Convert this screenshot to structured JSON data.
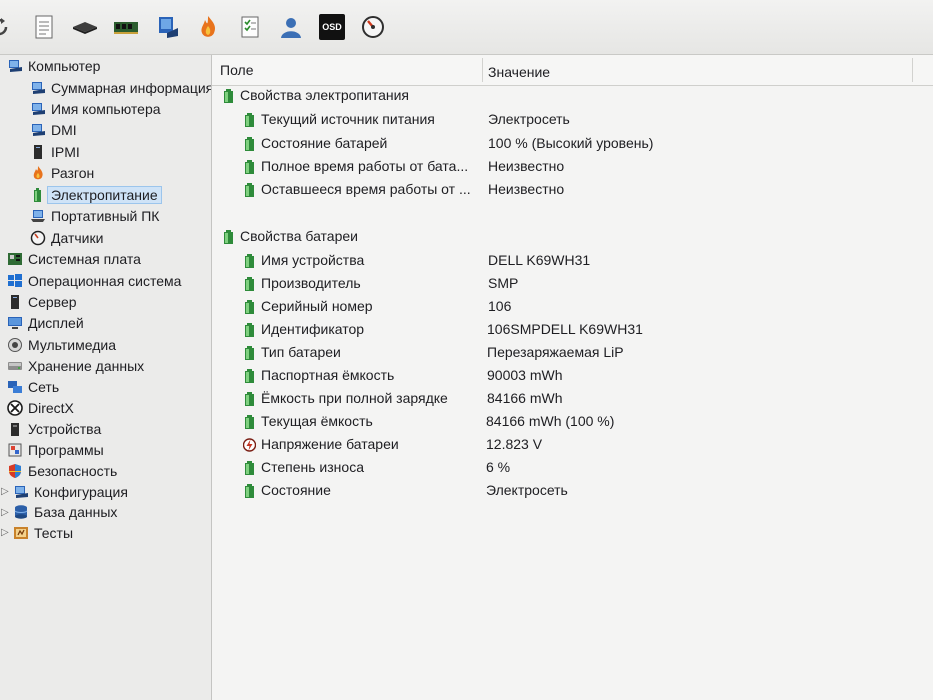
{
  "toolbar": {
    "icons": [
      "refresh-icon",
      "report-icon",
      "disk-icon",
      "memory-icon",
      "computer-icon",
      "flame-icon",
      "checklist-icon",
      "user-icon",
      "osd-icon",
      "gauge-icon"
    ],
    "osd_label": "OSD"
  },
  "tree": {
    "items": [
      {
        "label": "Компьютер",
        "icon": "computer-icon",
        "level": 0,
        "expanded": true
      },
      {
        "label": "Суммарная информация",
        "icon": "computer-icon",
        "level": 1
      },
      {
        "label": "Имя компьютера",
        "icon": "computer-icon",
        "level": 1
      },
      {
        "label": "DMI",
        "icon": "computer-icon",
        "level": 1
      },
      {
        "label": "IPMI",
        "icon": "server-icon",
        "level": 1
      },
      {
        "label": "Разгон",
        "icon": "flame-icon",
        "level": 1
      },
      {
        "label": "Электропитание",
        "icon": "battery-icon",
        "level": 1,
        "selected": true
      },
      {
        "label": "Портативный ПК",
        "icon": "laptop-icon",
        "level": 1
      },
      {
        "label": "Датчики",
        "icon": "gauge-icon",
        "level": 1
      },
      {
        "label": "Системная плата",
        "icon": "motherboard-icon",
        "level": 0
      },
      {
        "label": "Операционная система",
        "icon": "windows-icon",
        "level": 0
      },
      {
        "label": "Сервер",
        "icon": "server-icon",
        "level": 0
      },
      {
        "label": "Дисплей",
        "icon": "monitor-icon",
        "level": 0
      },
      {
        "label": "Мультимедиа",
        "icon": "speaker-icon",
        "level": 0
      },
      {
        "label": "Хранение данных",
        "icon": "storage-icon",
        "level": 0
      },
      {
        "label": "Сеть",
        "icon": "network-icon",
        "level": 0
      },
      {
        "label": "DirectX",
        "icon": "xbox-icon",
        "level": 0
      },
      {
        "label": "Устройства",
        "icon": "device-icon",
        "level": 0
      },
      {
        "label": "Программы",
        "icon": "programs-icon",
        "level": 0
      },
      {
        "label": "Безопасность",
        "icon": "shield-icon",
        "level": 0
      },
      {
        "label": "Конфигурация",
        "icon": "config-icon",
        "level": 0
      },
      {
        "label": "База данных",
        "icon": "database-icon",
        "level": 0
      },
      {
        "label": "Тесты",
        "icon": "tests-icon",
        "level": 0
      }
    ]
  },
  "list": {
    "header": {
      "field": "Поле",
      "value": "Значение"
    },
    "groups": [
      {
        "title": "Свойства электропитания",
        "rows": [
          {
            "field": "Текущий источник питания",
            "value": "Электросеть"
          },
          {
            "field": "Состояние батарей",
            "value": "100 % (Высокий уровень)"
          },
          {
            "field": "Полное время работы от бата...",
            "value": "Неизвестно"
          },
          {
            "field": "Оставшееся время работы от ...",
            "value": "Неизвестно"
          }
        ]
      },
      {
        "title": "Свойства батареи",
        "rows": [
          {
            "field": "Имя устройства",
            "value": "DELL K69WH31"
          },
          {
            "field": "Производитель",
            "value": "SMP"
          },
          {
            "field": "Серийный номер",
            "value": "106"
          },
          {
            "field": "Идентификатор",
            "value": "106SMPDELL K69WH31"
          },
          {
            "field": "Тип батареи",
            "value": "Перезаряжаемая LiP"
          },
          {
            "field": "Паспортная ёмкость",
            "value": "90003 mWh"
          },
          {
            "field": "Ёмкость при полной зарядке",
            "value": "84166 mWh"
          },
          {
            "field": "Текущая ёмкость",
            "value": "84166 mWh  (100 %)"
          },
          {
            "field": "Напряжение батареи",
            "value": "12.823 V",
            "icon": "voltage-icon"
          },
          {
            "field": "Степень износа",
            "value": "6 %"
          },
          {
            "field": "Состояние",
            "value": "Электросеть"
          }
        ]
      }
    ]
  }
}
